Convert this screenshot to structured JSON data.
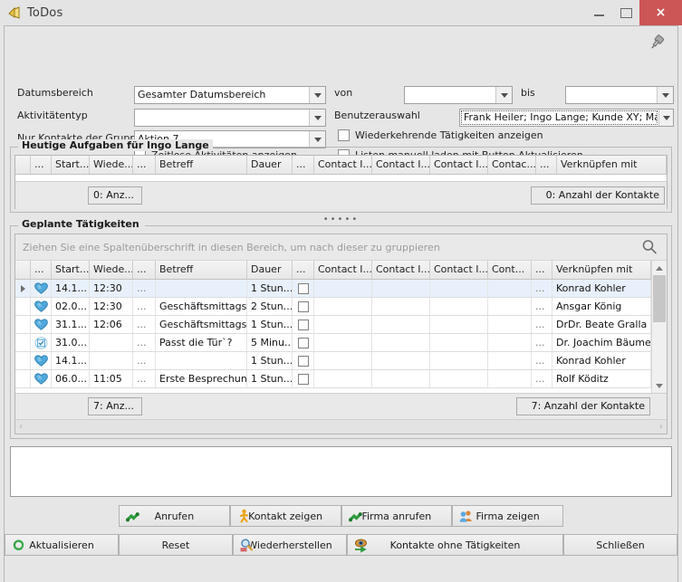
{
  "window": {
    "title": "ToDos",
    "icon": "bell-icon",
    "minimize_label": "–",
    "maximize_label": "□",
    "close_label": "×"
  },
  "filters": {
    "pin_icon": "pin-icon",
    "date_range_label": "Datumsbereich",
    "date_range_value": "Gesamter Datumsbereich",
    "activity_type_label": "Aktivitätentyp",
    "activity_type_value": "",
    "group_label": "Nur Kontakte der Gruppe",
    "group_value": "Aktion 7",
    "from_label": "von",
    "from_value": "",
    "to_label": "bis",
    "to_value": "",
    "user_select_label": "Benutzerauswahl",
    "user_select_value": "Frank Heiler; Ingo Lange; Kunde XY; Mark ...",
    "checkbox_timeless": "Zeitlose Aktivitäten anzeigen",
    "checkbox_recurring": "Wiederkehrende Tätigkeiten anzeigen",
    "checkbox_manual_load": "Listen manuell laden mit Button Aktualisieren"
  },
  "today": {
    "title": "Heutige Aufgaben für  Ingo Lange",
    "columns": [
      "",
      "...",
      "Start...",
      "Wiede...",
      "...",
      "Betreff",
      "Dauer",
      "...",
      "Contact I...",
      "Contact I...",
      "Contact I...",
      "Contac...",
      "...",
      "Verknüpfen mit"
    ],
    "rows": [],
    "footer_left": "0: Anz...",
    "footer_right": "0: Anzahl der Kontakte"
  },
  "planned": {
    "title": "Geplante Tätigkeiten",
    "group_hint": "Ziehen Sie eine Spaltenüberschrift in diesen Bereich, um nach dieser zu gruppieren",
    "search_icon": "search-icon",
    "columns": [
      "",
      "...",
      "Start...",
      "Wiede...",
      "...",
      "Betreff",
      "Dauer",
      "...",
      "Contact I...",
      "Contact I...",
      "Contact I...",
      "Cont...",
      "...",
      "Verknüpfen mit"
    ],
    "rows": [
      {
        "indicator": "▸",
        "icon": "heart-icon",
        "start": "14.1...",
        "wieder": "12:30",
        "dots1": "...",
        "betreff": "",
        "dauer": "1 Stun...",
        "check": false,
        "ci1": "",
        "ci2": "",
        "ci3": "",
        "ci4": "",
        "dots2": "...",
        "link": "Konrad Kohler",
        "selected": true
      },
      {
        "indicator": "",
        "icon": "heart-icon",
        "start": "02.0...",
        "wieder": "12:30",
        "dots1": "...",
        "betreff": "Geschäftsmittags...",
        "dauer": "2 Stun...",
        "check": false,
        "ci1": "",
        "ci2": "",
        "ci3": "",
        "ci4": "",
        "dots2": "...",
        "link": "Ansgar König",
        "selected": false
      },
      {
        "indicator": "",
        "icon": "heart-icon",
        "start": "31.1...",
        "wieder": "12:06",
        "dots1": "...",
        "betreff": "Geschäftsmittags...",
        "dauer": "1 Stun...",
        "check": false,
        "ci1": "",
        "ci2": "",
        "ci3": "",
        "ci4": "",
        "dots2": "...",
        "link": "DrDr. Beate Gralla",
        "selected": false
      },
      {
        "indicator": "",
        "icon": "task-check-icon",
        "start": "31.0...",
        "wieder": "",
        "dots1": "...",
        "betreff": "Passt die Tür`?",
        "dauer": "5 Minu...",
        "check": false,
        "ci1": "",
        "ci2": "",
        "ci3": "",
        "ci4": "",
        "dots2": "...",
        "link": "Dr. Joachim Bäumer",
        "selected": false
      },
      {
        "indicator": "",
        "icon": "heart-icon",
        "start": "14.1...",
        "wieder": "",
        "dots1": "...",
        "betreff": "",
        "dauer": "1 Stun...",
        "check": false,
        "ci1": "",
        "ci2": "",
        "ci3": "",
        "ci4": "",
        "dots2": "...",
        "link": "Konrad Kohler",
        "selected": false
      },
      {
        "indicator": "",
        "icon": "heart-icon",
        "start": "06.0...",
        "wieder": "11:05",
        "dots1": "...",
        "betreff": "Erste Besprechung",
        "dauer": "1 Stun...",
        "check": false,
        "ci1": "",
        "ci2": "",
        "ci3": "",
        "ci4": "",
        "dots2": "...",
        "link": "Rolf Köditz",
        "selected": false
      }
    ],
    "footer_left": "7: Anz...",
    "footer_right": "7: Anzahl der Kontakte",
    "hscroll_left": "‹",
    "hscroll_right": "›"
  },
  "splitter": "•••••",
  "actions_row1": [
    {
      "label": "Anrufen",
      "icon": "phone-icon"
    },
    {
      "label": "Kontakt zeigen",
      "icon": "person-walking-icon"
    },
    {
      "label": "Firma anrufen",
      "icon": "phone-icon"
    },
    {
      "label": "Firma zeigen",
      "icon": "people-icon"
    }
  ],
  "actions_row2": [
    {
      "label": "Aktualisieren",
      "icon": "refresh-icon"
    },
    {
      "label": "Reset",
      "icon": ""
    },
    {
      "label": "Wiederherstellen",
      "icon": "magnifier-restore-icon"
    },
    {
      "label": "Kontakte ohne Tätigkeiten",
      "icon": "eye-arrow-icon"
    },
    {
      "label": "Schließen",
      "icon": ""
    }
  ],
  "colors": {
    "accent": "#cc5555",
    "selection": "#e8f1fb",
    "window_bg": "#e6e6e6",
    "icon_blue": "#4fa8dc",
    "icon_green": "#2e9b3e"
  }
}
